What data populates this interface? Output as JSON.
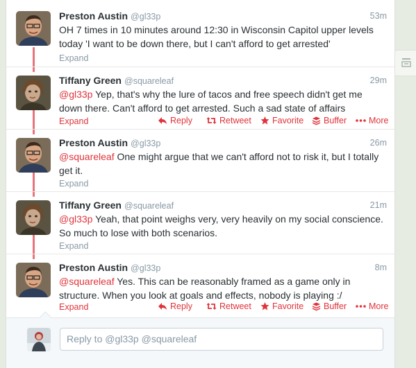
{
  "tweets": [
    {
      "author": "Preston Austin",
      "handle": "@gl33p",
      "time": "53m",
      "mention": "",
      "text": "OH 7 times in 10 minutes around 12:30 in Wisconsin Capitol upper levels today 'I want to be down there, but I can't afford to get arrested'",
      "expand_label": "Expand"
    },
    {
      "author": "Tiffany Green",
      "handle": "@squareleaf",
      "time": "29m",
      "mention": "@gl33p",
      "text": " Yep, that's why the lure of tacos and free speech didn't get me down there. Can't afford to get arrested. Such a sad state of affairs",
      "expand_label": "Expand"
    },
    {
      "author": "Preston Austin",
      "handle": "@gl33p",
      "time": "26m",
      "mention": "@squareleaf",
      "text": " One might argue that we can't afford not to risk it, but I totally get it.",
      "expand_label": "Expand"
    },
    {
      "author": "Tiffany Green",
      "handle": "@squareleaf",
      "time": "21m",
      "mention": "@gl33p",
      "text": " Yeah, that point weighs very, very heavily on my social conscience. So much to lose with both scenarios.",
      "expand_label": "Expand"
    },
    {
      "author": "Preston Austin",
      "handle": "@gl33p",
      "time": "8m",
      "mention": "@squareleaf",
      "text": " Yes. This can be reasonably framed as a game only in structure. When you look at goals and effects, nobody is playing :/",
      "expand_label": "Expand"
    }
  ],
  "actions": {
    "reply": "Reply",
    "retweet": "Retweet",
    "favorite": "Favorite",
    "buffer": "Buffer",
    "more": "More"
  },
  "reply_box": {
    "placeholder": "Reply to @gl33p @squareleaf"
  },
  "colors": {
    "accent": "#e0333a",
    "thread_line": "#e8737a",
    "muted": "#8899a6"
  }
}
